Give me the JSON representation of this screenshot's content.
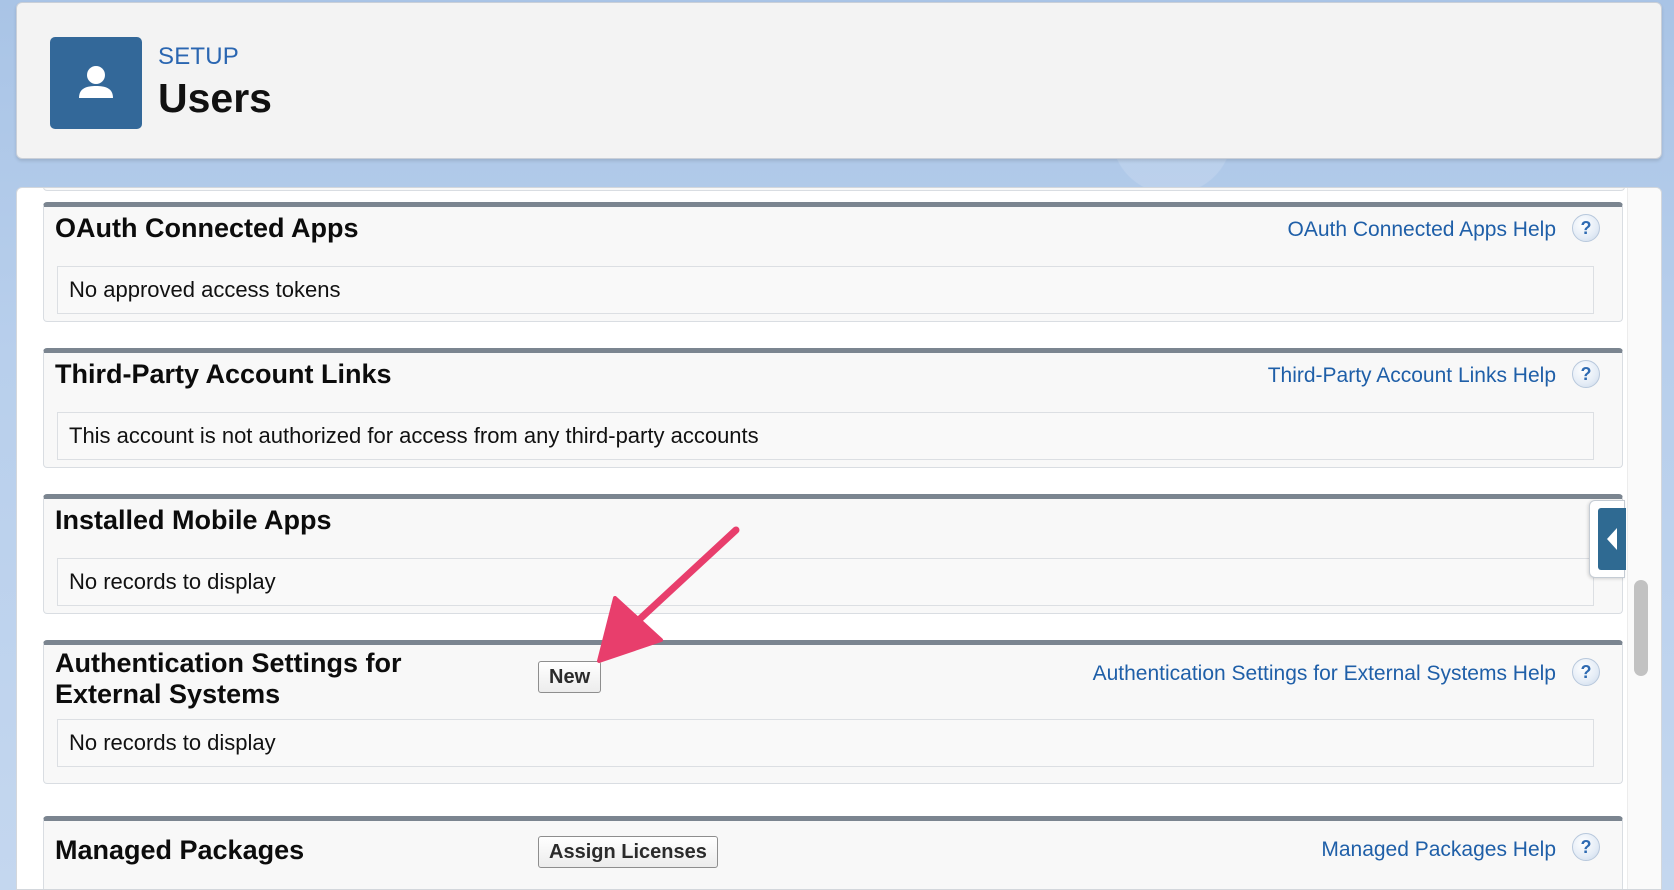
{
  "header": {
    "section_label": "SETUP",
    "title": "Users",
    "icon": "user-icon"
  },
  "sections": [
    {
      "title": "OAuth Connected Apps",
      "help_link": "OAuth Connected Apps Help",
      "body": "No approved access tokens"
    },
    {
      "title": "Third-Party Account Links",
      "help_link": "Third-Party Account Links Help",
      "body": "This account is not authorized for access from any third-party accounts"
    },
    {
      "title": "Installed Mobile Apps",
      "body": "No records to display"
    },
    {
      "title_line1": "Authentication Settings for",
      "title_line2": "External Systems",
      "button": "New",
      "help_link": "Authentication Settings for External Systems Help",
      "body": "No records to display"
    },
    {
      "title": "Managed Packages",
      "button": "Assign Licenses",
      "help_link": "Managed Packages Help"
    }
  ],
  "help_icon_glyph": "?",
  "colors": {
    "link": "#1f5fa8",
    "header_icon_bg": "#336899",
    "section_border": "#7b8590",
    "annotation_arrow": "#e83e6c"
  }
}
